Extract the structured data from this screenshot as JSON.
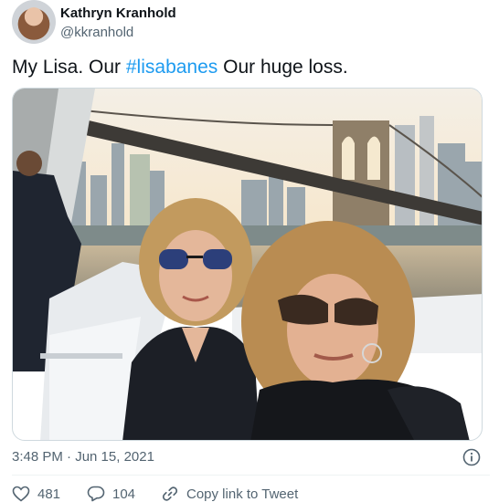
{
  "author": {
    "display_name": "Kathryn Kranhold",
    "handle": "@kkranhold"
  },
  "tweet": {
    "text_before": "My Lisa. Our ",
    "hashtag": "#lisabanes",
    "text_after": " Our huge loss.",
    "timestamp": "3:48 PM · Jun 15, 2021"
  },
  "actions": {
    "likes": "481",
    "replies": "104",
    "copy_link_label": "Copy link to Tweet"
  },
  "icons": {
    "like": "heart-icon",
    "reply": "speech-bubble-icon",
    "copy": "link-icon",
    "info": "info-icon"
  },
  "colors": {
    "hashtag": "#1d9bf0",
    "secondary_text": "#536471"
  }
}
